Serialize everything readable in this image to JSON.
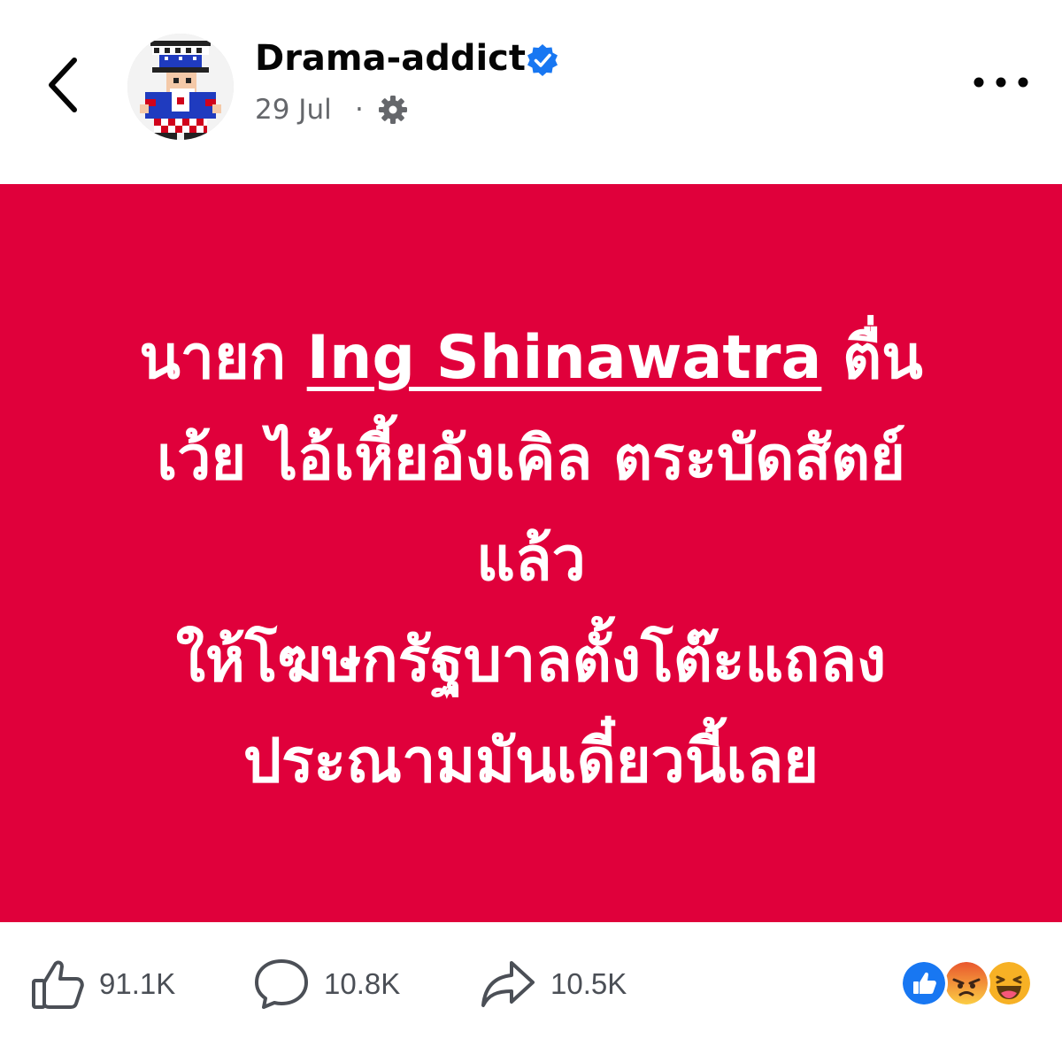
{
  "post": {
    "author": "Drama-addict",
    "date": "29 Jul",
    "separator": "·",
    "verified": true,
    "icons": {
      "back": "chevron-left-icon",
      "audience": "gear-icon",
      "more": "more-dots-icon"
    }
  },
  "banner": {
    "background_color": "#e0003b",
    "line1_before": "นายก ",
    "line1_mention": "Ing Shinawatra",
    "line1_after": " ตื่น",
    "line2": "เว้ย ไอ้เหี้ยอังเคิล ตระบัดสัตย์",
    "line3": "แล้ว",
    "line4": "ให้โฆษกรัฐบาลตั้งโต๊ะแถลง",
    "line5": "ประณามมันเดี๋ยวนี้เลย"
  },
  "actions": {
    "likes": "91.1K",
    "comments": "10.8K",
    "shares": "10.5K",
    "reactions": [
      "like",
      "angry",
      "haha"
    ]
  },
  "colors": {
    "accent_blue": "#1877f2",
    "muted_text": "#65676b",
    "angry": "#f0633a",
    "haha": "#f7b125"
  }
}
